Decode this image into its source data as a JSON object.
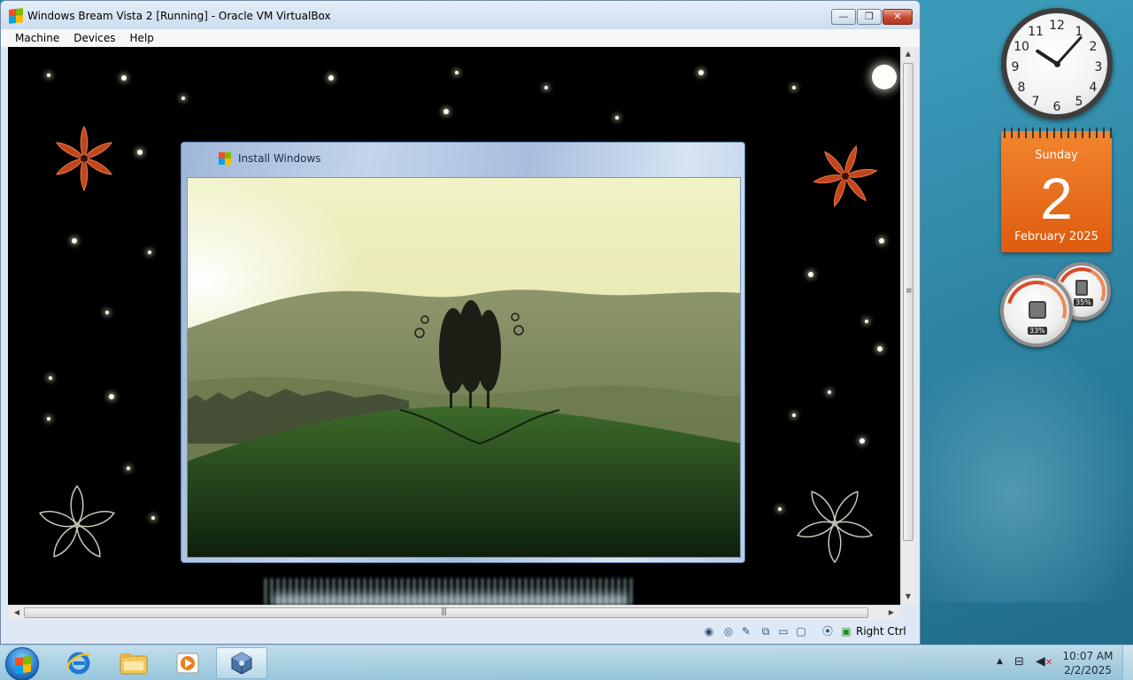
{
  "vbox": {
    "title": "Windows Bream Vista 2 [Running] - Oracle VM VirtualBox",
    "controls": {
      "minimize": "—",
      "restore": "❐",
      "close": "✕"
    },
    "menu": [
      "Machine",
      "Devices",
      "Help"
    ],
    "status": {
      "host_key": "Right Ctrl"
    },
    "status_icons": [
      "hard-disk-icon",
      "optical-drive-icon",
      "usb-icon",
      "network-icon",
      "shared-folders-icon",
      "display-icon",
      "capture-icon",
      "mouse-integration-icon"
    ]
  },
  "guest": {
    "install_window": {
      "title": "Install Windows"
    }
  },
  "gadgets": {
    "clock": {
      "time": "10:07",
      "numbers": [
        "12",
        "1",
        "2",
        "3",
        "4",
        "5",
        "6",
        "7",
        "8",
        "9",
        "10",
        "11"
      ]
    },
    "calendar": {
      "weekday": "Sunday",
      "day": "2",
      "month_year": "February 2025"
    },
    "cpu_meter": {
      "cpu": "33%",
      "memory": "35%"
    }
  },
  "taskbar": {
    "pinned": [
      "internet-explorer-icon",
      "windows-explorer-icon",
      "media-player-icon",
      "virtualbox-icon"
    ],
    "active": "virtualbox-icon",
    "tray": {
      "time": "10:07 AM",
      "date": "2/2/2025"
    },
    "colors": {
      "accent": "#2b7fd0"
    }
  }
}
